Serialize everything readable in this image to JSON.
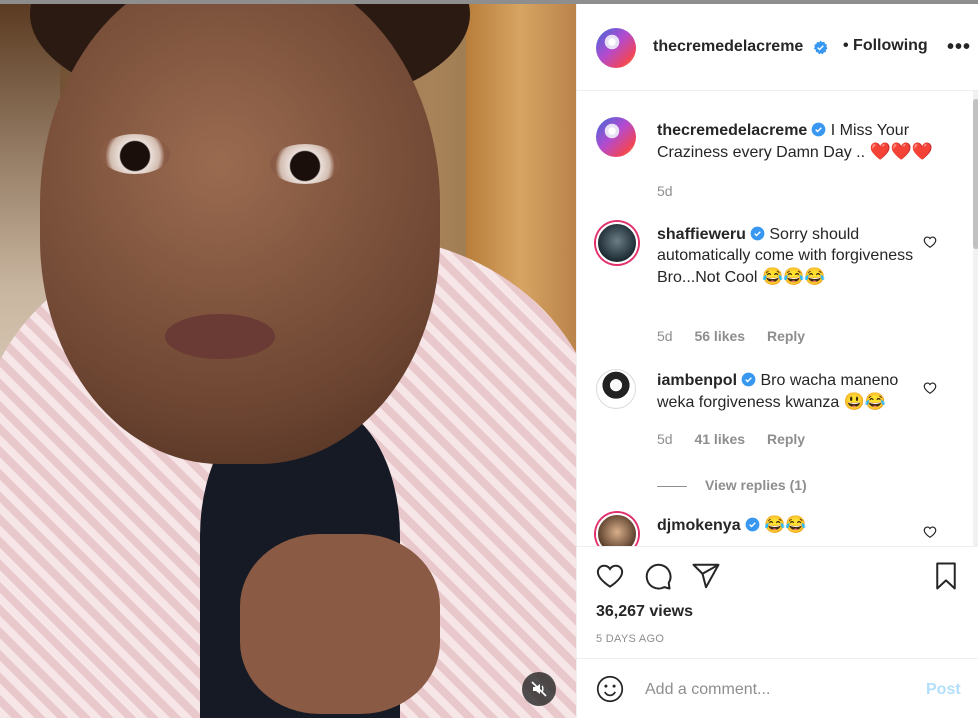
{
  "post": {
    "username": "thecremedelacreme",
    "follow_status": "Following",
    "more_icon": "•••",
    "caption": {
      "username": "thecremedelacreme",
      "text": "I Miss Your Craziness every Damn Day ..",
      "emojis": "❤️❤️❤️",
      "time": "5d"
    },
    "comments": [
      {
        "username": "shaffieweru",
        "text": "Sorry should automatically come with forgiveness Bro...Not Cool",
        "emojis": "😂😂😂",
        "time": "5d",
        "likes": "56 likes",
        "reply_label": "Reply"
      },
      {
        "username": "iambenpol",
        "text": "Bro wacha maneno weka forgiveness kwanza",
        "emojis": "😃😂",
        "time": "5d",
        "likes": "41 likes",
        "reply_label": "Reply",
        "view_replies": "View replies (1)"
      },
      {
        "username": "djmokenya",
        "text": "",
        "emojis": "😂😂"
      }
    ],
    "views": "36,267 views",
    "date": "5 DAYS AGO",
    "add_comment_placeholder": "Add a comment...",
    "post_button": "Post"
  },
  "colors": {
    "verified": "#3897f0",
    "post_button_disabled": "#b2dffc",
    "meta_text": "#8e8e8e"
  },
  "icons": [
    "verified-badge-icon",
    "heart-icon",
    "comment-icon",
    "share-icon",
    "bookmark-icon",
    "emoji-icon",
    "mute-icon",
    "more-options-icon"
  ]
}
